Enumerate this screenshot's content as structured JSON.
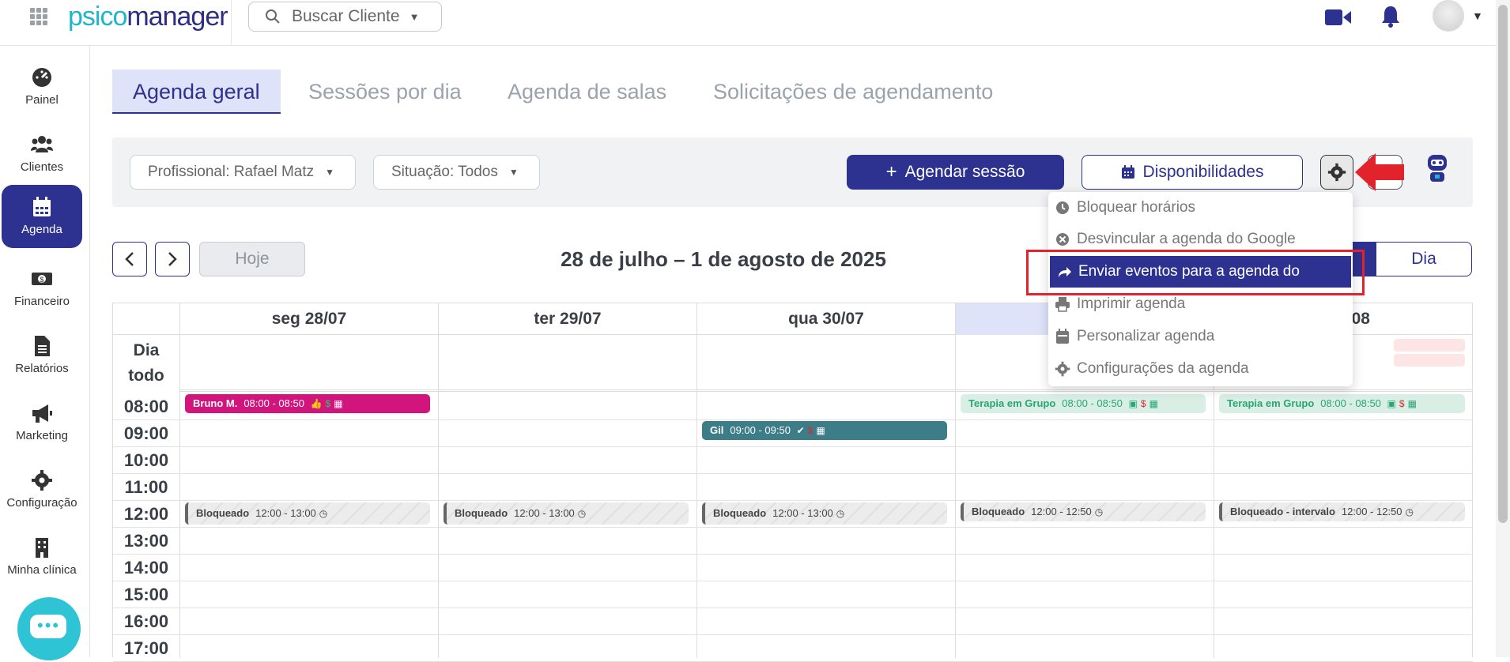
{
  "topbar": {
    "logo_part1": "psico",
    "logo_part2": "manager",
    "search_placeholder": "Buscar Cliente",
    "icons": [
      "apps-grid-icon",
      "search-icon",
      "video-icon",
      "bell-icon",
      "avatar"
    ]
  },
  "sidebar": {
    "items": [
      {
        "label": "Painel",
        "icon": "dashboard-icon"
      },
      {
        "label": "Clientes",
        "icon": "users-icon"
      },
      {
        "label": "Agenda",
        "icon": "calendar-icon"
      },
      {
        "label": "Financeiro",
        "icon": "money-icon"
      },
      {
        "label": "Relatórios",
        "icon": "document-icon"
      },
      {
        "label": "Marketing",
        "icon": "megaphone-icon"
      },
      {
        "label": "Configuração",
        "icon": "gear-icon"
      },
      {
        "label": "Minha clínica",
        "icon": "building-icon"
      }
    ]
  },
  "tabs": [
    {
      "label": "Agenda geral"
    },
    {
      "label": "Sessões por dia"
    },
    {
      "label": "Agenda de salas"
    },
    {
      "label": "Solicitações de agendamento"
    }
  ],
  "filters": {
    "professional": "Profissional: Rafael Matz",
    "status": "Situação: Todos",
    "schedule_button": "Agendar sessão",
    "availability_button": "Disponibilidades"
  },
  "calendar_nav": {
    "today": "Hoje",
    "range_title": "28 de julho – 1 de agosto de 2025",
    "view_day": "Dia"
  },
  "calendar": {
    "all_day_label_1": "Dia",
    "all_day_label_2": "todo",
    "days": [
      "seg 28/07",
      "ter 29/07",
      "qua 30/07",
      "",
      "/08"
    ],
    "hours": [
      "08:00",
      "09:00",
      "10:00",
      "11:00",
      "12:00",
      "13:00",
      "14:00",
      "15:00",
      "16:00",
      "17:00"
    ],
    "events": {
      "bruno": {
        "title": "Bruno M.",
        "time": "08:00 - 08:50"
      },
      "gil": {
        "title": "Gil",
        "time": "09:00 - 09:50"
      },
      "grupo1": {
        "title": "Terapia em Grupo",
        "time": "08:00 - 08:50"
      },
      "grupo2": {
        "title": "Terapia em Grupo",
        "time": "08:00 - 08:50"
      },
      "bloq1": {
        "title": "Bloqueado",
        "time": "12:00 - 13:00"
      },
      "bloq2": {
        "title": "Bloqueado",
        "time": "12:00 - 13:00"
      },
      "bloq3": {
        "title": "Bloqueado",
        "time": "12:00 - 13:00"
      },
      "bloq4": {
        "title": "Bloqueado",
        "time": "12:00 - 12:50"
      },
      "bloq5": {
        "title": "Bloqueado - intervalo",
        "time": "12:00 - 12:50"
      }
    }
  },
  "settings_menu": {
    "items": [
      {
        "label": "Bloquear horários",
        "icon": "clock-icon"
      },
      {
        "label": "Desvincular a agenda do Google",
        "icon": "close-circle-icon"
      },
      {
        "label": "Enviar eventos para a agenda do Google",
        "icon": "share-arrow-icon"
      },
      {
        "label": "Imprimir agenda",
        "icon": "printer-icon"
      },
      {
        "label": "Personalizar agenda",
        "icon": "calendar-icon"
      },
      {
        "label": "Configurações da agenda",
        "icon": "gear-icon"
      }
    ]
  },
  "colors": {
    "brand": "#2d3190",
    "accent": "#1fb6c9",
    "event_pink": "#d2147d",
    "event_teal": "#3c7d87",
    "highlight": "#e3232c"
  }
}
